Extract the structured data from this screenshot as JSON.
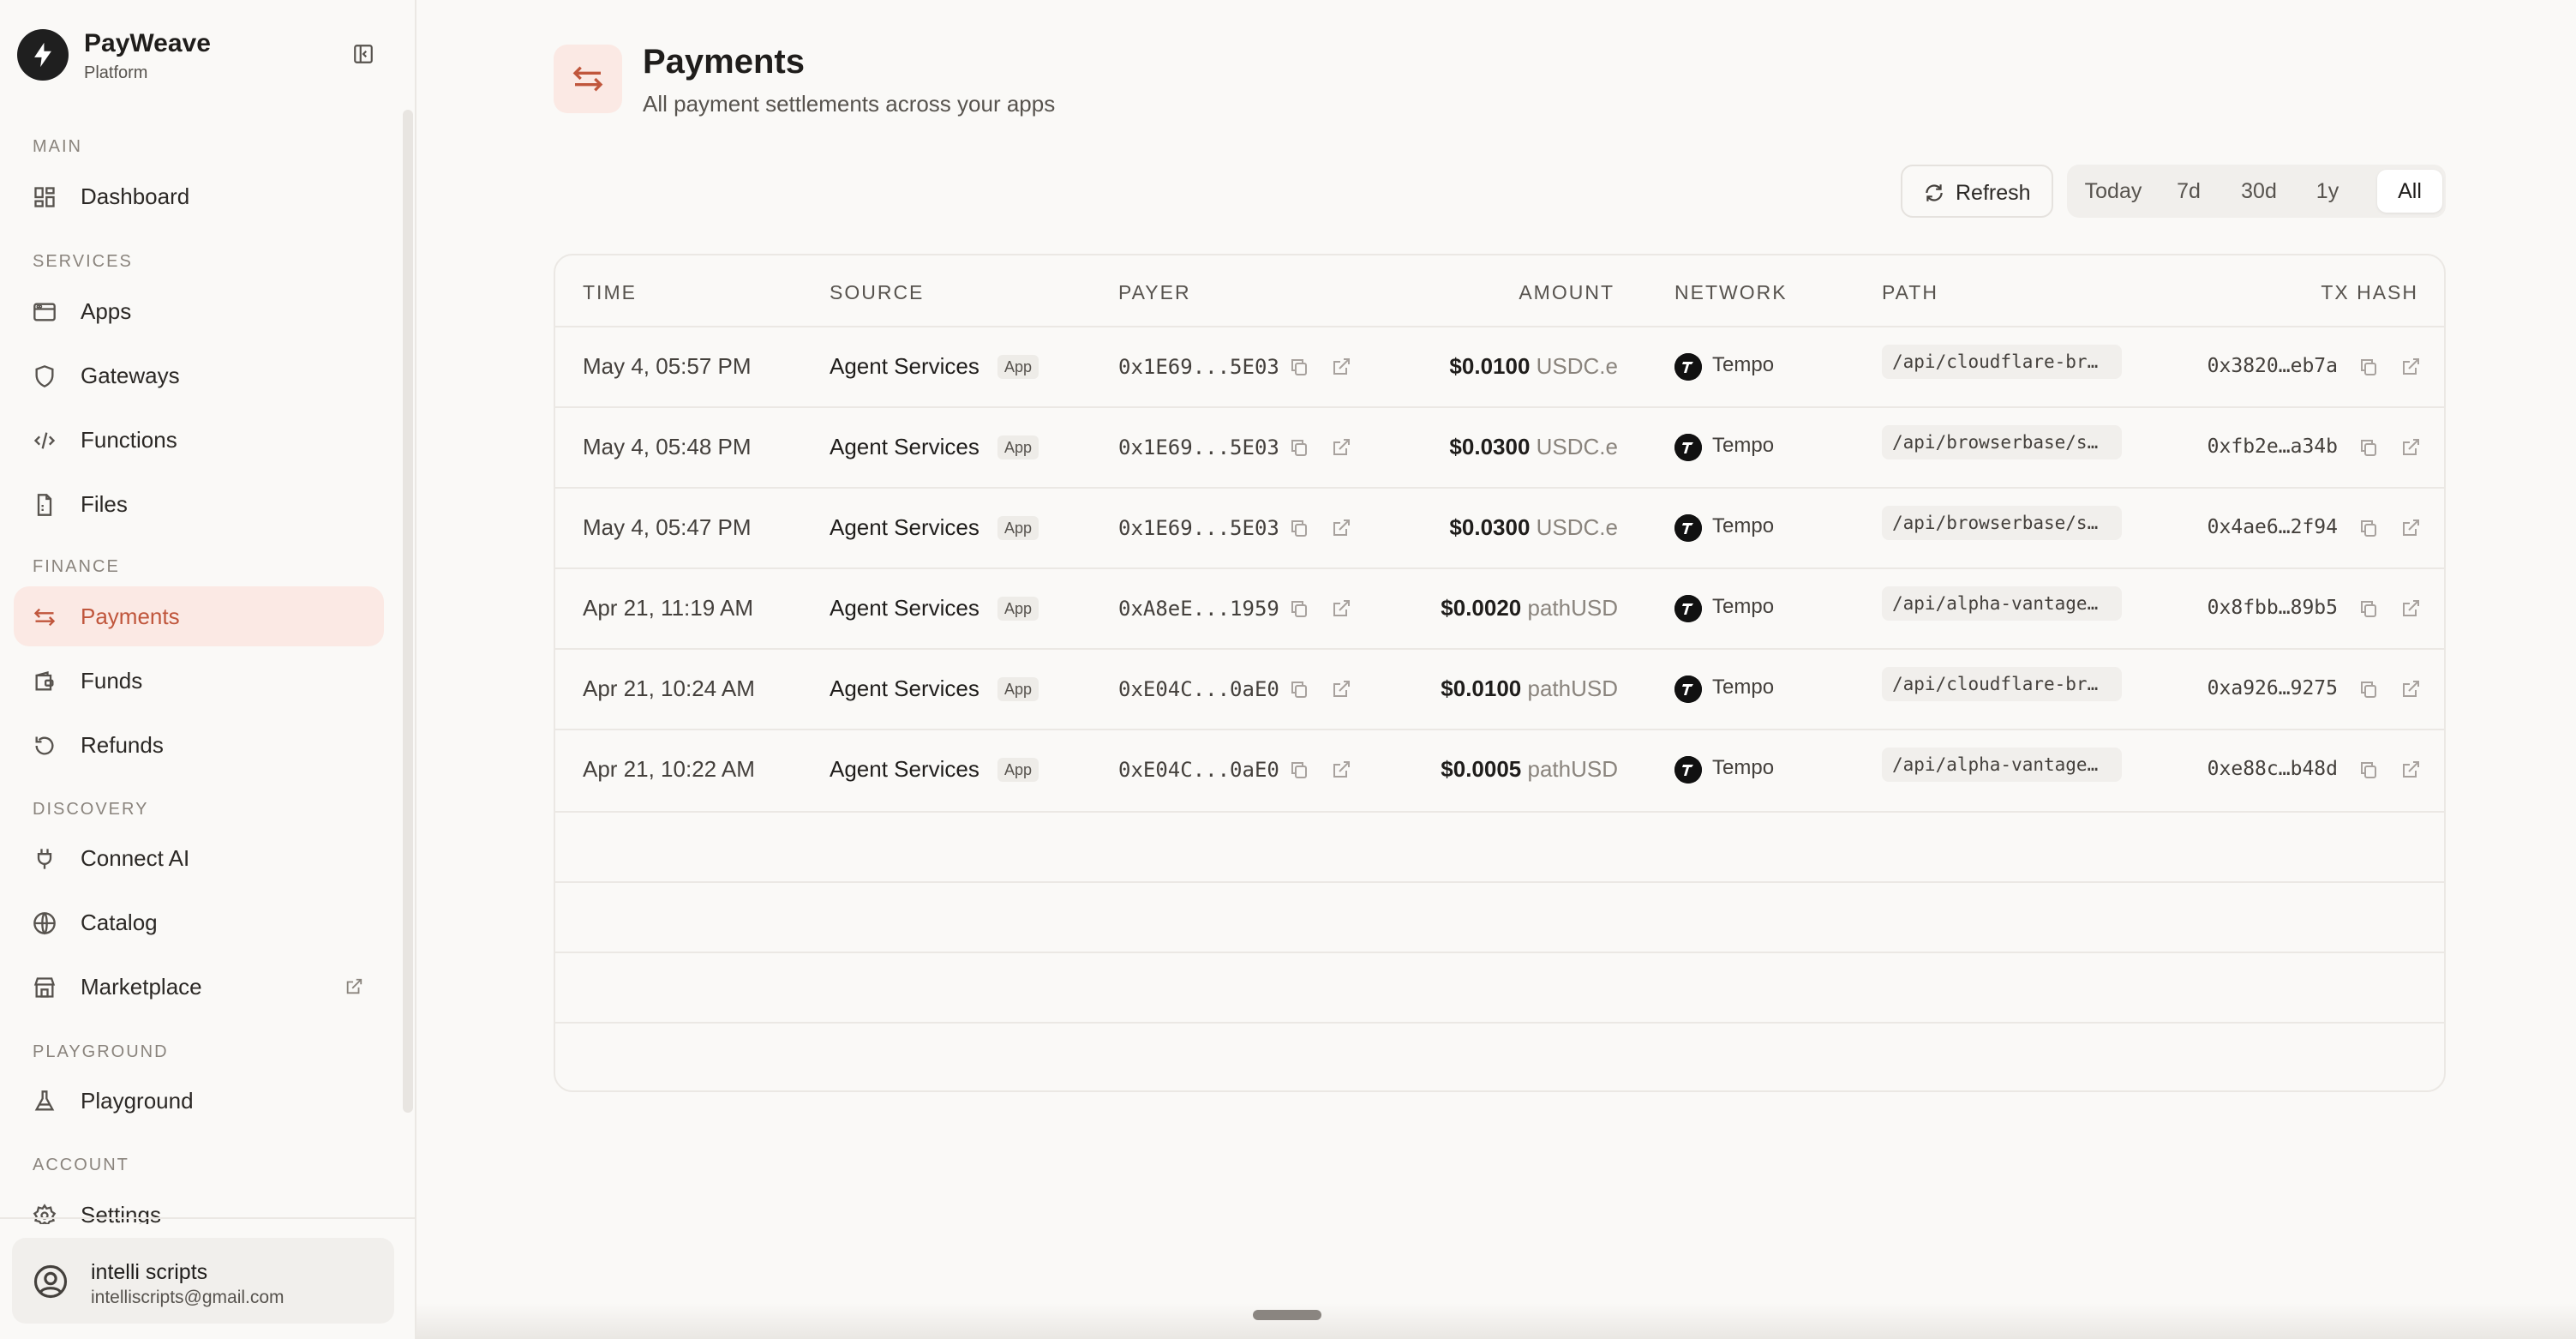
{
  "brand": {
    "name": "PayWeave",
    "subtitle": "Platform"
  },
  "nav": {
    "sections": {
      "main": "MAIN",
      "services": "SERVICES",
      "finance": "FINANCE",
      "discovery": "DISCOVERY",
      "playground": "PLAYGROUND",
      "account": "ACCOUNT"
    },
    "items": {
      "dashboard": "Dashboard",
      "apps": "Apps",
      "gateways": "Gateways",
      "functions": "Functions",
      "files": "Files",
      "payments": "Payments",
      "funds": "Funds",
      "refunds": "Refunds",
      "connect_ai": "Connect AI",
      "catalog": "Catalog",
      "marketplace": "Marketplace",
      "playground": "Playground",
      "settings": "Settings"
    },
    "active": "Payments"
  },
  "user": {
    "name": "intelli scripts",
    "email": "intelliscripts@gmail.com"
  },
  "page": {
    "title": "Payments",
    "subtitle": "All payment settlements across your apps"
  },
  "toolbar": {
    "refresh_label": "Refresh",
    "ranges": [
      "Today",
      "7d",
      "30d",
      "1y",
      "All"
    ],
    "selected_range": "All"
  },
  "table": {
    "columns": {
      "time": "TIME",
      "source": "SOURCE",
      "payer": "PAYER",
      "amount": "AMOUNT",
      "network": "NETWORK",
      "path": "PATH",
      "tx_hash": "TX HASH"
    },
    "rows": [
      {
        "time": "May 4, 05:57 PM",
        "source": "Agent Services",
        "badge": "App",
        "payer": "0x1E69...5E03",
        "amount": "$0.0100",
        "token": "USDC.e",
        "network": "Tempo",
        "path": "/api/cloudflare-br…",
        "tx_hash": "0x3820…eb7a"
      },
      {
        "time": "May 4, 05:48 PM",
        "source": "Agent Services",
        "badge": "App",
        "payer": "0x1E69...5E03",
        "amount": "$0.0300",
        "token": "USDC.e",
        "network": "Tempo",
        "path": "/api/browserbase/s…",
        "tx_hash": "0xfb2e…a34b"
      },
      {
        "time": "May 4, 05:47 PM",
        "source": "Agent Services",
        "badge": "App",
        "payer": "0x1E69...5E03",
        "amount": "$0.0300",
        "token": "USDC.e",
        "network": "Tempo",
        "path": "/api/browserbase/s…",
        "tx_hash": "0x4ae6…2f94"
      },
      {
        "time": "Apr 21, 11:19 AM",
        "source": "Agent Services",
        "badge": "App",
        "payer": "0xA8eE...1959",
        "amount": "$0.0020",
        "token": "pathUSD",
        "network": "Tempo",
        "path": "/api/alpha-vantage…",
        "tx_hash": "0x8fbb…89b5"
      },
      {
        "time": "Apr 21, 10:24 AM",
        "source": "Agent Services",
        "badge": "App",
        "payer": "0xE04C...0aE0",
        "amount": "$0.0100",
        "token": "pathUSD",
        "network": "Tempo",
        "path": "/api/cloudflare-br…",
        "tx_hash": "0xa926…9275"
      },
      {
        "time": "Apr 21, 10:22 AM",
        "source": "Agent Services",
        "badge": "App",
        "payer": "0xE04C...0aE0",
        "amount": "$0.0005",
        "token": "pathUSD",
        "network": "Tempo",
        "path": "/api/alpha-vantage…",
        "tx_hash": "0xe88c…b48d"
      }
    ]
  },
  "colors": {
    "accent": "#c0563c",
    "accent_bg": "#fbe9e4",
    "background": "#faf9f7",
    "border": "#ebe8e4"
  },
  "icons": {
    "brand": "bolt-icon",
    "collapse": "sidebar-collapse-icon",
    "dashboard": "grid-icon",
    "apps": "window-icon",
    "gateways": "shield-icon",
    "functions": "code-icon",
    "files": "file-icon",
    "payments": "arrows-swap-icon",
    "funds": "wallet-icon",
    "refunds": "rotate-ccw-icon",
    "connect_ai": "plug-icon",
    "catalog": "globe-icon",
    "marketplace": "store-icon",
    "playground": "flask-icon",
    "settings": "gear-icon",
    "user": "user-circle-icon",
    "refresh": "refresh-icon",
    "copy": "copy-icon",
    "external": "external-link-icon",
    "network": "tempo-logo-icon"
  }
}
